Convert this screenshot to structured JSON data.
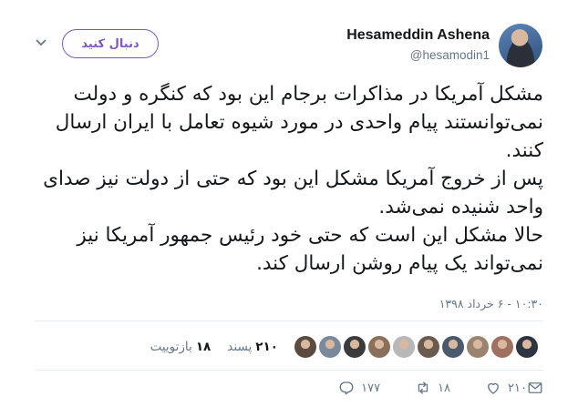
{
  "header": {
    "follow_label": "دنبال کنید",
    "name": "Hesameddin Ashena",
    "handle": "@hesamodin1"
  },
  "tweet": {
    "text": "مشکل آمریکا در مذاکرات برجام این بود که کنگره و دولت نمی‌توانستند پیام واحدی در مورد شیوه تعامل با ایران ارسال کنند.\nپس از خروج آمریکا مشکل این بود که حتی از دولت نیز صدای واحد شنیده نمی‌شد.\nحالا مشکل این است که حتی خود رئیس جمهور آمریکا نیز نمی‌تواند یک پیام روشن ارسال کند.",
    "timestamp": "۱۰:۳۰ - ۶ خرداد ۱۳۹۸"
  },
  "stats": {
    "retweets_count": "۱۸",
    "retweets_label": "بازتوییت",
    "likes_count": "۲۱۰",
    "likes_label": "پسند",
    "liker_faces": [
      "#5b4a3e",
      "#7a8a9a",
      "#3b3b3b",
      "#8a6f5a",
      "#b8b8b8",
      "#6b5a4e",
      "#4a5a6a",
      "#9a8470",
      "#a07060",
      "#2e3440"
    ]
  },
  "actions": {
    "reply_count": "۱۷۷",
    "retweet_count": "۱۸",
    "like_count": "۲۱۰"
  },
  "colors": {
    "accent": "#7e57c2",
    "muted": "#657786",
    "divider": "#e6ecf0"
  }
}
